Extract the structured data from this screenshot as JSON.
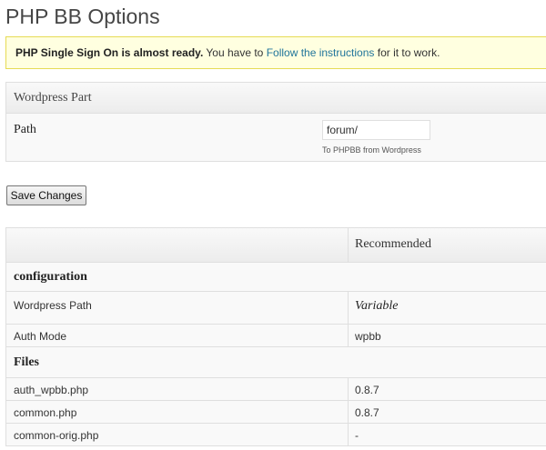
{
  "page": {
    "title": "PHP BB Options"
  },
  "notice": {
    "bold": "PHP Single Sign On is almost ready.",
    "text_before_link": " You have to ",
    "link": "Follow the instructions",
    "text_after_link": " for it to work."
  },
  "wordpress_part": {
    "header": "Wordpress Part",
    "path_label": "Path",
    "path_value": "forum/",
    "path_hint": "To PHPBB from Wordpress"
  },
  "actions": {
    "save_label": "Save Changes"
  },
  "status_table": {
    "col_recommended": "Recommended",
    "sections": [
      {
        "title": "configuration",
        "rows": [
          {
            "name": "Wordpress Path",
            "value": "Variable"
          },
          {
            "name": "Auth Mode",
            "value": "wpbb"
          }
        ]
      },
      {
        "title": "Files",
        "rows": [
          {
            "name": "auth_wpbb.php",
            "value": "0.8.7"
          },
          {
            "name": "common.php",
            "value": "0.8.7"
          },
          {
            "name": "common-orig.php",
            "value": "-"
          }
        ]
      }
    ]
  },
  "colors": {
    "notice_bg": "#ffffe0",
    "notice_border": "#e6db55",
    "link": "#21759b",
    "border": "#dfdfdf"
  }
}
